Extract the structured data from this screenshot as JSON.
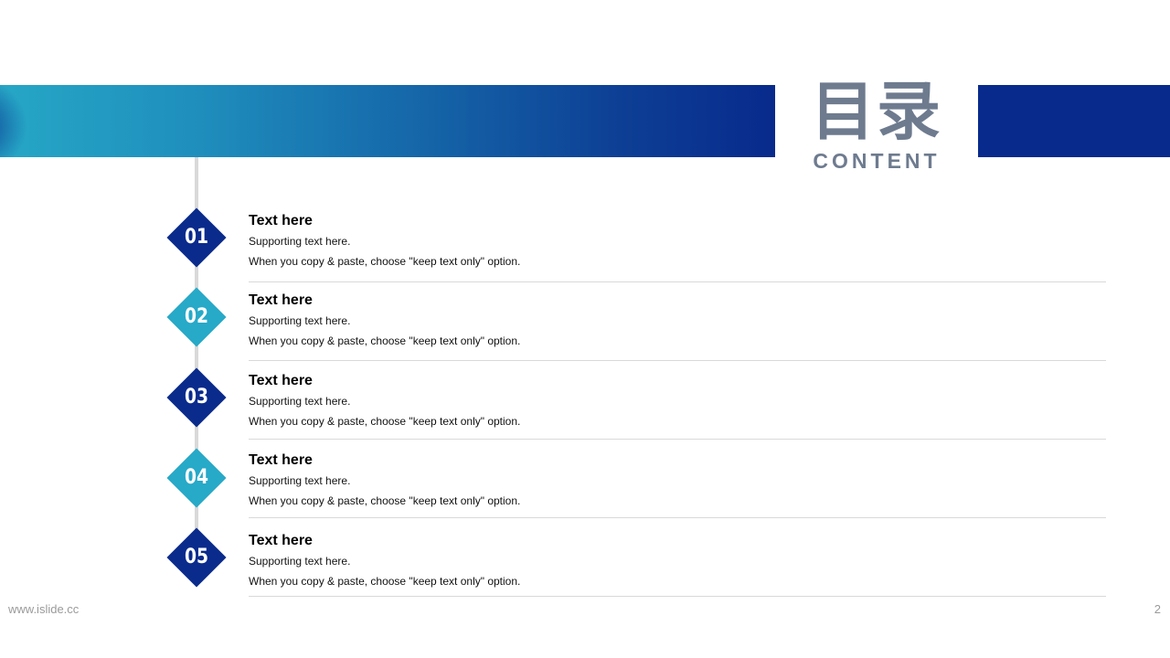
{
  "header": {
    "title_cn": "目录",
    "title_en": "CONTENT"
  },
  "items": [
    {
      "number": "01",
      "title": "Text here",
      "subtitle": "Supporting text here.",
      "description": "When you copy & paste, choose \"keep text only\" option.",
      "accent": "dark"
    },
    {
      "number": "02",
      "title": "Text here",
      "subtitle": "Supporting text here.",
      "description": "When you copy & paste, choose \"keep text only\" option.",
      "accent": "light"
    },
    {
      "number": "03",
      "title": "Text here",
      "subtitle": "Supporting text here.",
      "description": "When you copy & paste, choose \"keep text only\" option.",
      "accent": "dark"
    },
    {
      "number": "04",
      "title": "Text here",
      "subtitle": "Supporting text here.",
      "description": "When you copy & paste, choose \"keep text only\" option.",
      "accent": "light"
    },
    {
      "number": "05",
      "title": "Text here",
      "subtitle": "Supporting text here.",
      "description": "When you copy & paste, choose \"keep text only\" option.",
      "accent": "dark"
    }
  ],
  "footer": {
    "website": "www.islide.cc",
    "page_number": "2"
  },
  "colors": {
    "dark_blue": "#0a2b8c",
    "light_blue": "#27a9c8",
    "title_gray": "#6e7b8f"
  }
}
